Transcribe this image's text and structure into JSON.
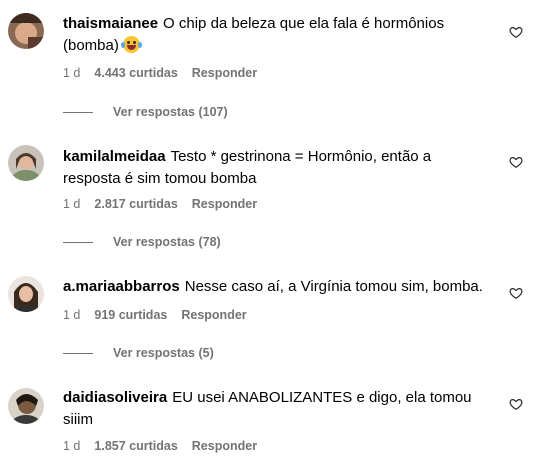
{
  "comments": [
    {
      "username": "thaismaianee",
      "text": "O chip da beleza que ela fala é hormônios (bomba)",
      "emoji_icon": "rolling-on-floor-laughing-emoji",
      "time": "1 d",
      "likes": "4.443 curtidas",
      "reply_label": "Responder",
      "view_replies": "Ver respostas (107)"
    },
    {
      "username": "kamilalmeidaa",
      "text": "Testo * gestrinona = Hormônio, então a resposta é sim tomou bomba",
      "time": "1 d",
      "likes": "2.817 curtidas",
      "reply_label": "Responder",
      "view_replies": "Ver respostas (78)"
    },
    {
      "username": "a.mariaabbarros",
      "text": "Nesse caso aí, a Virgínia tomou sim, bomba.",
      "time": "1 d",
      "likes": "919 curtidas",
      "reply_label": "Responder",
      "view_replies": "Ver respostas (5)"
    },
    {
      "username": "daidiasoliveira",
      "text": "EU usei ANABOLIZANTES e digo, ela tomou siiim",
      "time": "1 d",
      "likes": "1.857 curtidas",
      "reply_label": "Responder"
    }
  ],
  "icons": {
    "like": "heart-outline-icon"
  },
  "colors": {
    "text": "#000000",
    "meta": "#737373",
    "background": "#ffffff"
  }
}
